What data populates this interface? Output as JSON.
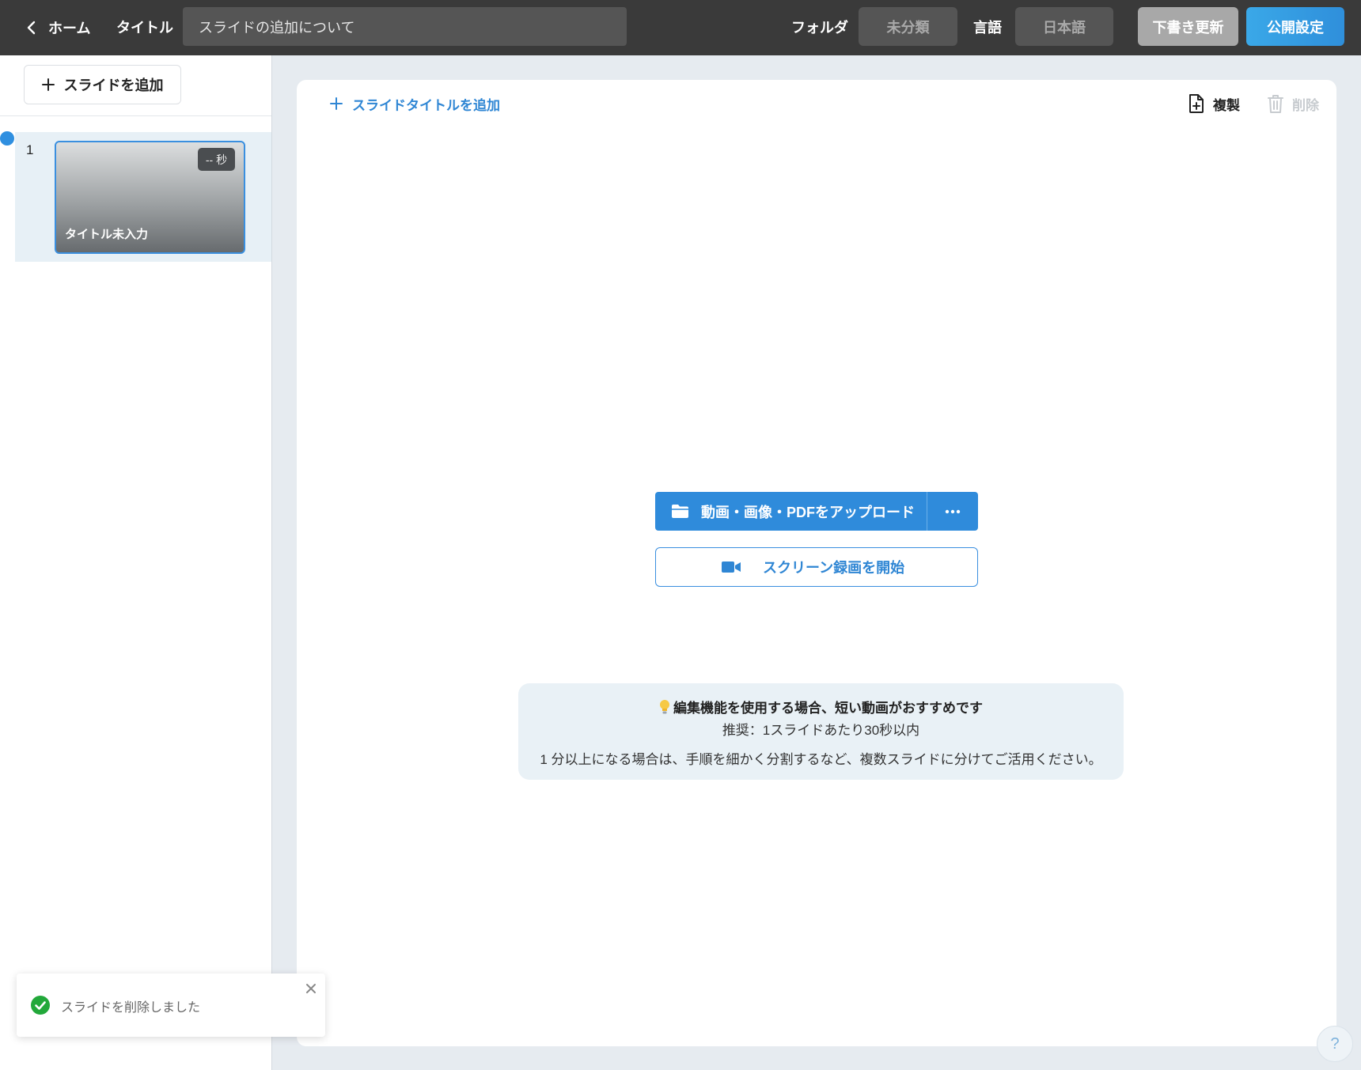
{
  "header": {
    "back_label": "ホーム",
    "title_label": "タイトル",
    "title_value": "スライドの追加について",
    "folder_label": "フォルダ",
    "folder_value": "未分類",
    "language_label": "言語",
    "language_value": "日本語",
    "draft_update_label": "下書き更新",
    "publish_settings_label": "公開設定"
  },
  "sidebar": {
    "add_slide_label": "スライドを追加",
    "slides": [
      {
        "number": "1",
        "duration": "-- 秒",
        "title": "タイトル未入力",
        "selected": true
      }
    ]
  },
  "editor": {
    "add_slide_title_label": "スライドタイトルを追加",
    "duplicate_label": "複製",
    "delete_label": "削除",
    "upload_label": "動画・画像・PDFをアップロード",
    "screen_record_label": "スクリーン録画を開始",
    "tip": {
      "heading": "編集機能を使用する場合、短い動画がおすすめです",
      "recommendation": "推奨：1スライドあたり30秒以内",
      "detail": "1 分以上になる場合は、手順を細かく分割するなど、複数スライドに分けてご活用ください。"
    }
  },
  "toast": {
    "message": "スライドを削除しました"
  },
  "help": {
    "label": "?"
  },
  "colors": {
    "header_bg": "#3a3a3a",
    "accent_blue": "#2f8bdb",
    "publish_button": "#2f9be0",
    "draft_button": "#a8a8a8",
    "success_green": "#22a83a",
    "main_bg": "#e6ebf0"
  },
  "icons": {
    "back": "chevron-left-icon",
    "add": "plus-icon",
    "upload": "folder-icon",
    "more": "ellipsis-icon",
    "record": "video-camera-icon",
    "duplicate": "file-plus-icon",
    "delete": "trash-icon",
    "tip": "lightbulb-icon",
    "toast_success": "check-circle-icon",
    "toast_close": "close-icon"
  }
}
